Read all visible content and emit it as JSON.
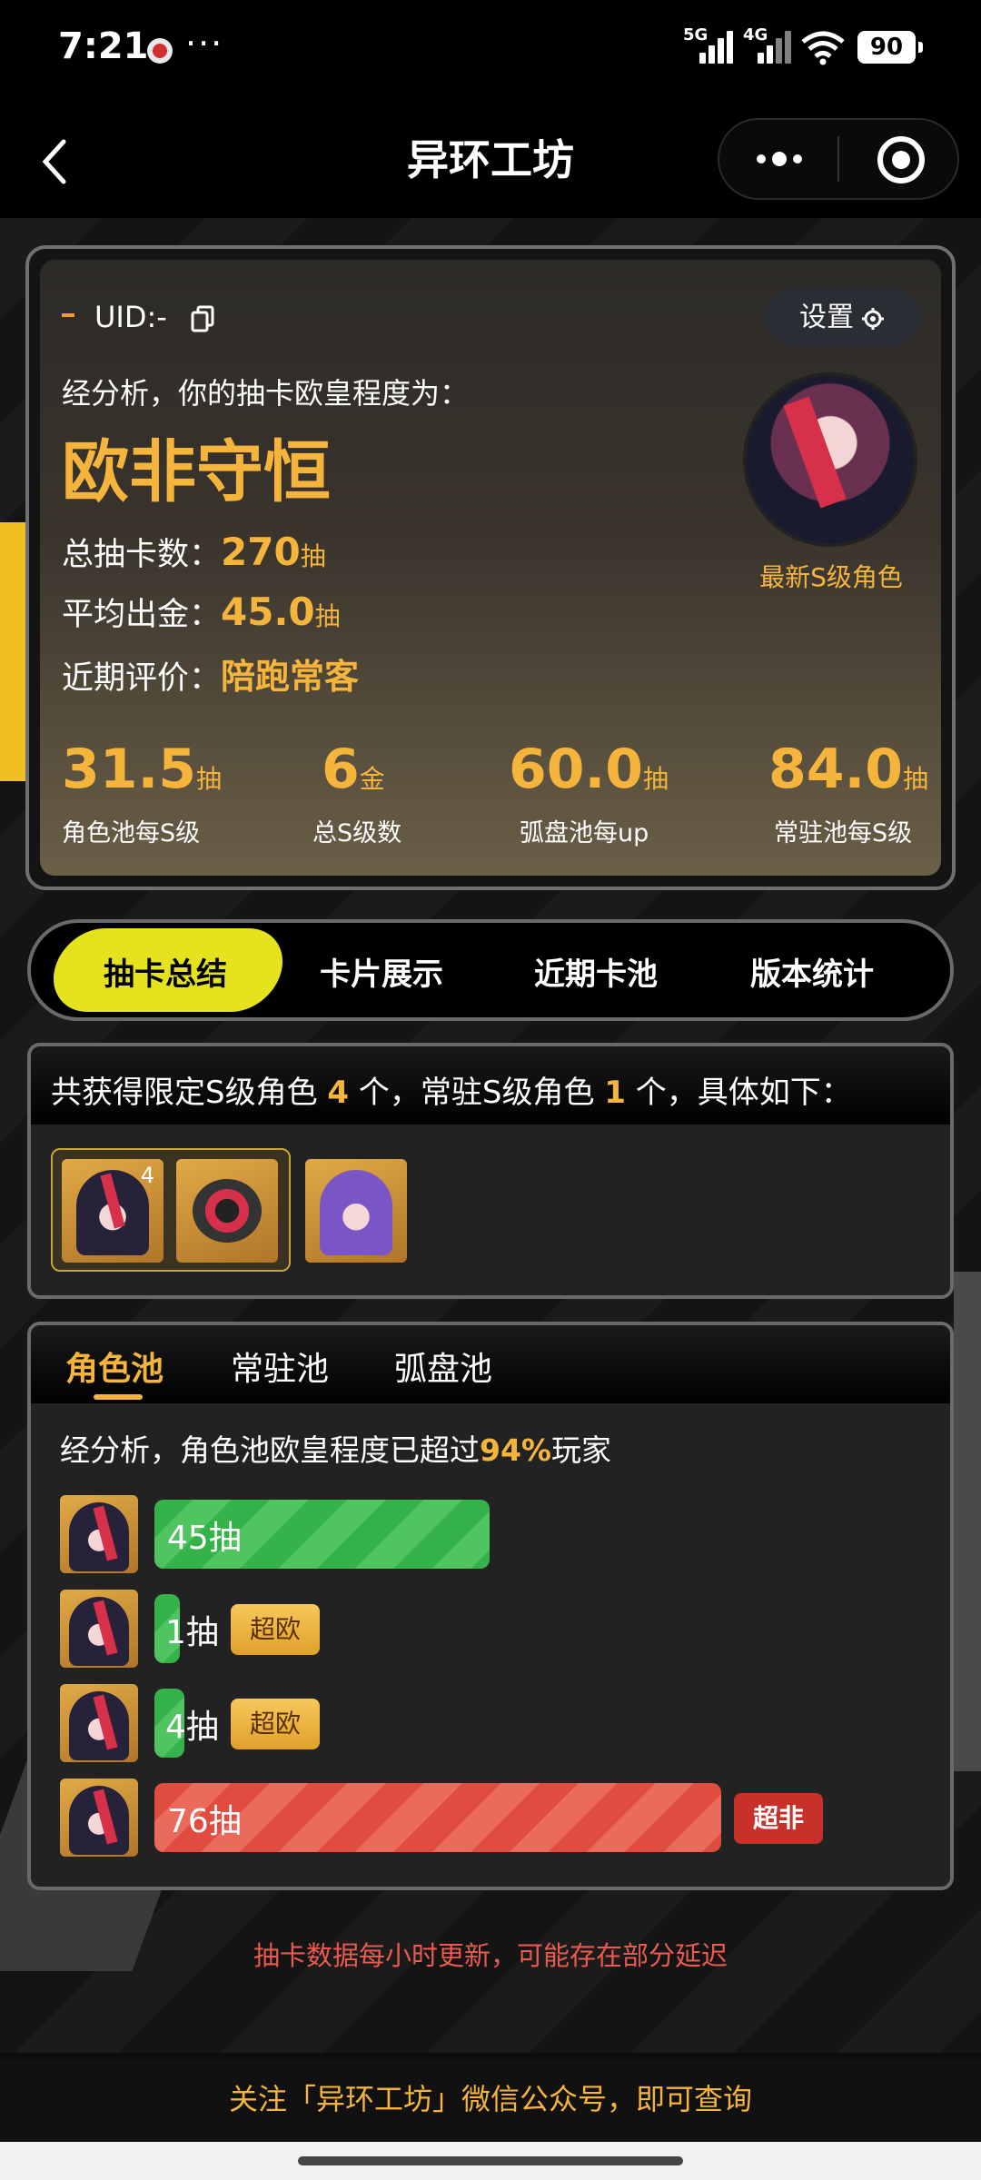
{
  "status": {
    "time": "7:21",
    "more": "···",
    "sig1": "5G",
    "sig2": "4G",
    "battery": "90"
  },
  "nav": {
    "title": "异环工坊"
  },
  "summary": {
    "uid": "UID:-",
    "settings": "设置",
    "analysis": "经分析，你的抽卡欧皇程度为：",
    "rank": "欧非守恒",
    "total_label": "总抽卡数：",
    "total_value": "270",
    "total_unit": "抽",
    "avg_label": "平均出金：",
    "avg_value": "45.0",
    "avg_unit": "抽",
    "recent_label": "近期评价：",
    "recent_value": "陪跑常客",
    "latest_s": "最新S级角色",
    "stats": [
      {
        "value": "31.5",
        "unit": "抽",
        "label": "角色池每S级"
      },
      {
        "value": "6",
        "unit": "金",
        "label": "总S级数"
      },
      {
        "value": "60.0",
        "unit": "抽",
        "label": "弧盘池每up"
      },
      {
        "value": "84.0",
        "unit": "抽",
        "label": "常驻池每S级"
      }
    ]
  },
  "tabs": [
    "抽卡总结",
    "卡片展示",
    "近期卡池",
    "版本统计"
  ],
  "obtained": {
    "p1": "共获得限定S级角色 ",
    "limited": "4",
    "p2": " 个，常驻S级角色 ",
    "standard": "1",
    "p3": " 个，具体如下：",
    "group_count": "4"
  },
  "pools": {
    "tabs": [
      "角色池",
      "常驻池",
      "弧盘池"
    ],
    "analysis_p1": "经分析，角色池欧皇程度已超过",
    "analysis_pct": "94%",
    "analysis_p2": "玩家",
    "pulls": [
      {
        "text": "45抽",
        "count": 45,
        "color": "green",
        "badge": ""
      },
      {
        "text": "1抽",
        "count": 1,
        "color": "green",
        "badge": "超欧"
      },
      {
        "text": "4抽",
        "count": 4,
        "color": "green",
        "badge": "超欧"
      },
      {
        "text": "76抽",
        "count": 76,
        "color": "red",
        "badge": "超非"
      }
    ]
  },
  "footer": {
    "update_note": "抽卡数据每小时更新，可能存在部分延迟",
    "follow": "关注「异环工坊」微信公众号，即可查询"
  }
}
